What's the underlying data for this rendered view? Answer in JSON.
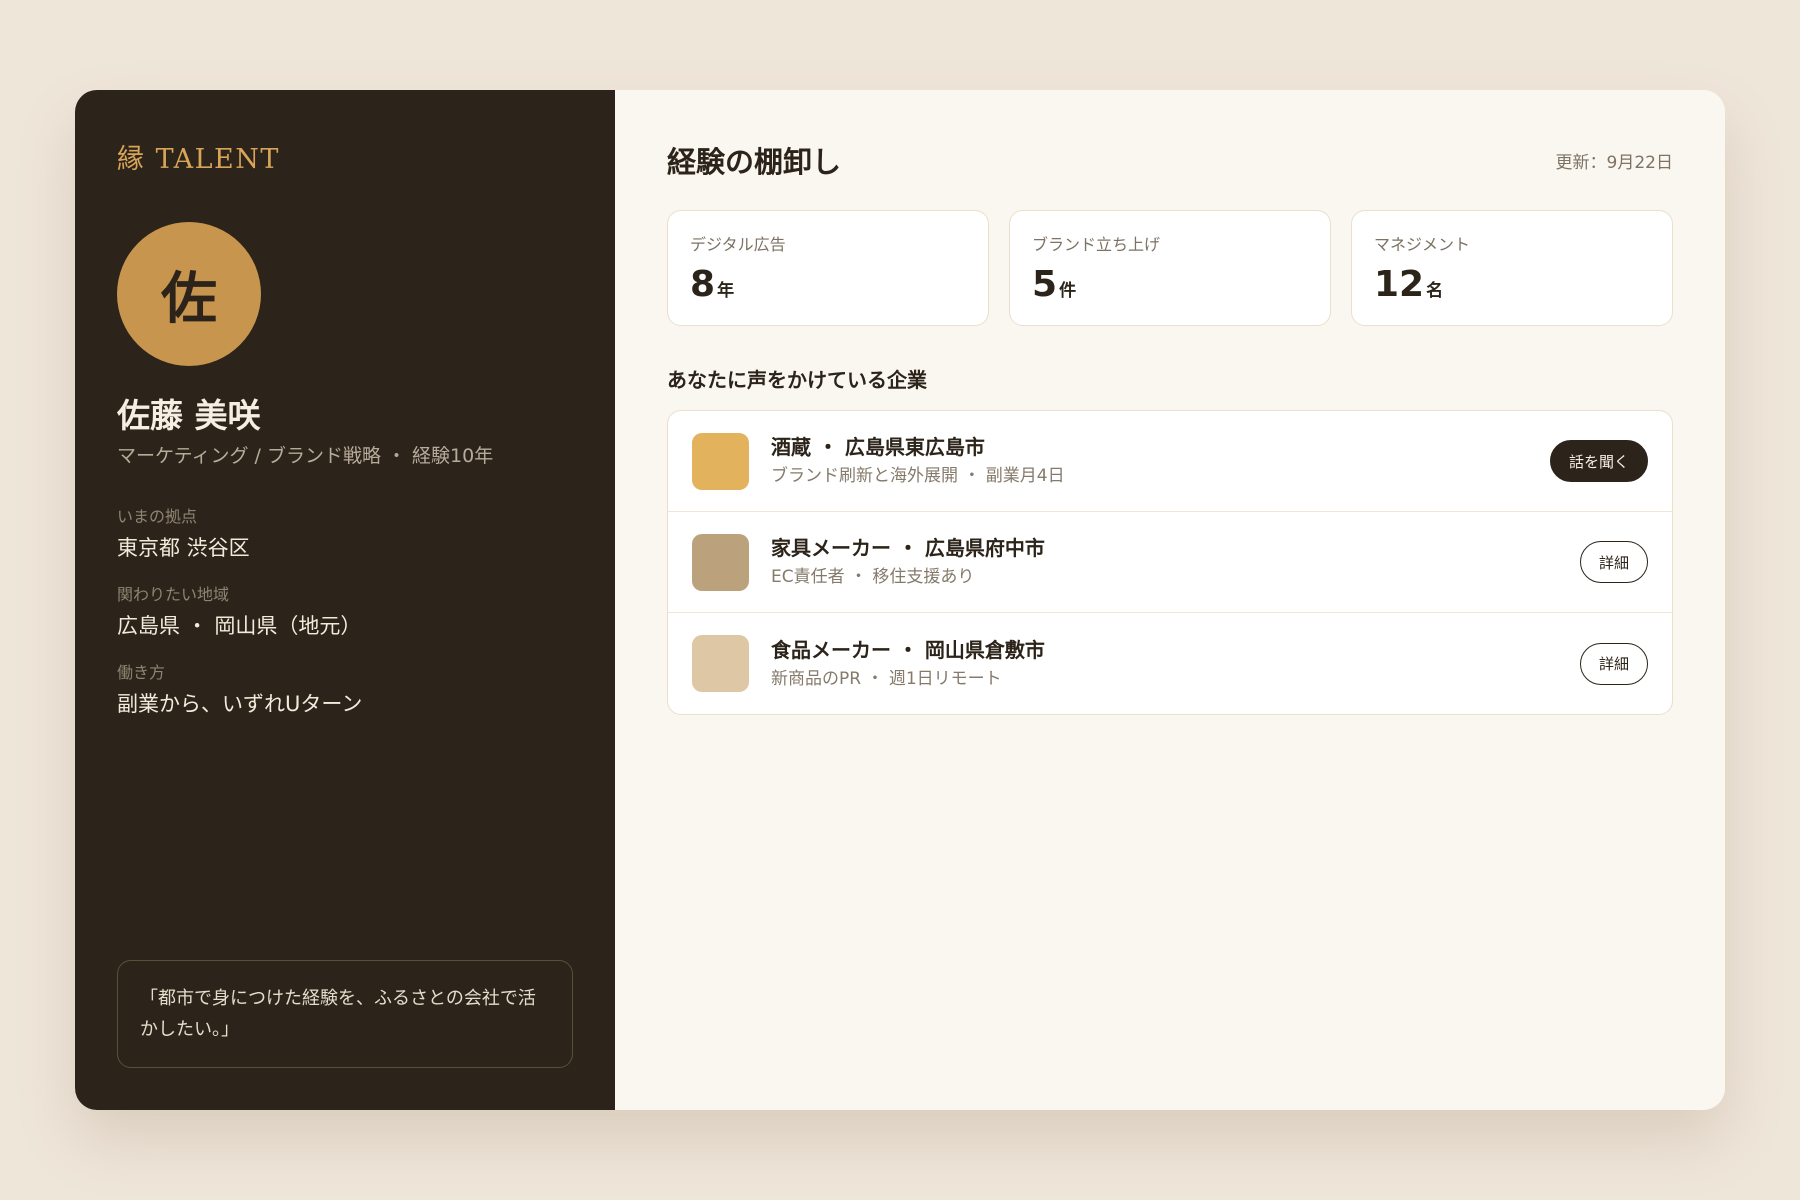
{
  "brand": {
    "logo_text": "縁 TALENT"
  },
  "profile": {
    "avatar_initial": "佐",
    "name": "佐藤 美咲",
    "role": "マーケティング / ブランド戦略 ・ 経験10年",
    "details": [
      {
        "label": "いまの拠点",
        "value": "東京都 渋谷区"
      },
      {
        "label": "関わりたい地域",
        "value": "広島県 ・ 岡山県（地元）"
      },
      {
        "label": "働き方",
        "value": "副業から、いずれUターン"
      }
    ],
    "quote": "「都市で身につけた経験を、ふるさとの会社で活かしたい。」"
  },
  "main": {
    "title": "経験の棚卸し",
    "updated": "更新：9月22日",
    "stats": [
      {
        "label": "デジタル広告",
        "value": "8",
        "unit": "年"
      },
      {
        "label": "ブランド立ち上げ",
        "value": "5",
        "unit": "件"
      },
      {
        "label": "マネジメント",
        "value": "12",
        "unit": "名"
      }
    ],
    "companies_title": "あなたに声をかけている企業",
    "companies": [
      {
        "name": "酒蔵 ・ 広島県東広島市",
        "desc": "ブランド刷新と海外展開 ・ 副業月4日",
        "button": "話を聞く",
        "swatch_color": "#e2b25c"
      },
      {
        "name": "家具メーカー ・ 広島県府中市",
        "desc": "EC責任者 ・ 移住支援あり",
        "button": "詳細",
        "swatch_color": "#bba27c"
      },
      {
        "name": "食品メーカー ・ 岡山県倉敷市",
        "desc": "新商品のPR ・ 週1日リモート",
        "button": "詳細",
        "swatch_color": "#dec7a4"
      }
    ]
  },
  "colors": {
    "page_bg": "#efe6da",
    "sidebar_bg": "#2c241a",
    "accent_gold": "#d7a458",
    "avatar_bg": "#c8954f",
    "content_bg": "#faf7f1"
  }
}
